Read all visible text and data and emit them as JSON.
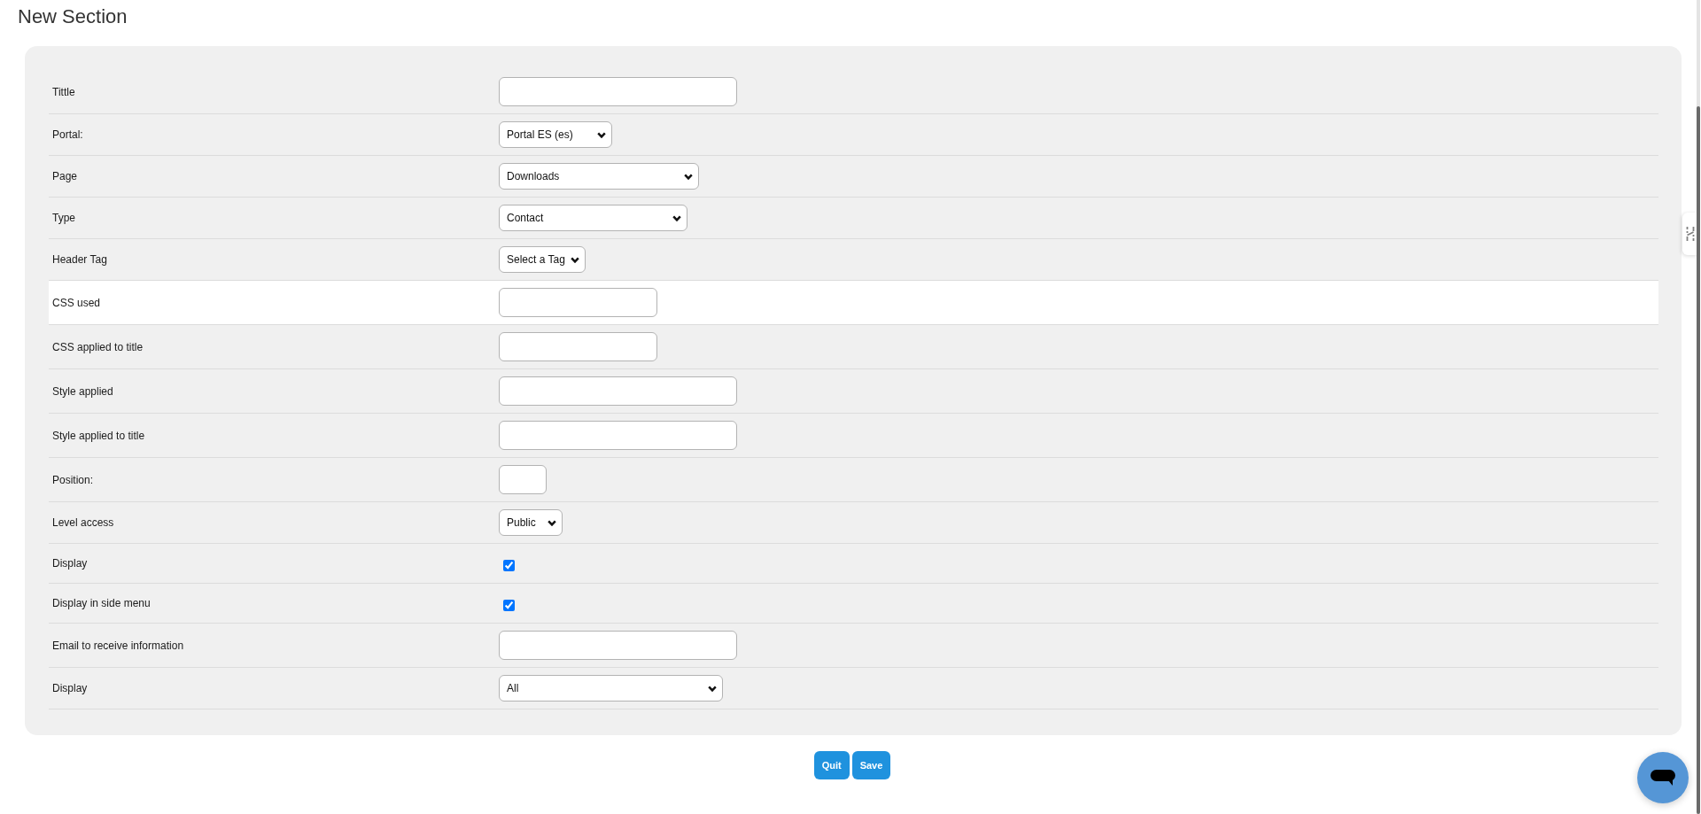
{
  "page_title": "New Section",
  "fields": [
    {
      "label": "Tittle",
      "kind": "text",
      "highlighted": false
    },
    {
      "label": "Portal:",
      "kind": "select",
      "value": "Portal ES (es)",
      "highlighted": false
    },
    {
      "label": "Page",
      "kind": "select",
      "value": "Downloads",
      "highlighted": false
    },
    {
      "label": "Type",
      "kind": "select",
      "value": "Contact",
      "highlighted": false
    },
    {
      "label": "Header Tag",
      "kind": "select",
      "value": "Select a Tag",
      "highlighted": false
    },
    {
      "label": "CSS used",
      "kind": "text",
      "highlighted": true
    },
    {
      "label": "CSS applied to title",
      "kind": "text",
      "highlighted": false
    },
    {
      "label": "Style applied",
      "kind": "text",
      "highlighted": false
    },
    {
      "label": "Style applied to title",
      "kind": "text",
      "highlighted": false
    },
    {
      "label": "Position:",
      "kind": "text",
      "highlighted": false
    },
    {
      "label": "Level access",
      "kind": "select",
      "value": "Public",
      "highlighted": false
    },
    {
      "label": "Display",
      "kind": "checkbox",
      "checked": true,
      "highlighted": false
    },
    {
      "label": "Display in side menu",
      "kind": "checkbox",
      "checked": true,
      "highlighted": false
    },
    {
      "label": "Email to receive information",
      "kind": "text",
      "highlighted": false
    },
    {
      "label": "Display",
      "kind": "select",
      "value": "All",
      "highlighted": false
    }
  ],
  "buttons": [
    "Quit",
    "Save"
  ]
}
